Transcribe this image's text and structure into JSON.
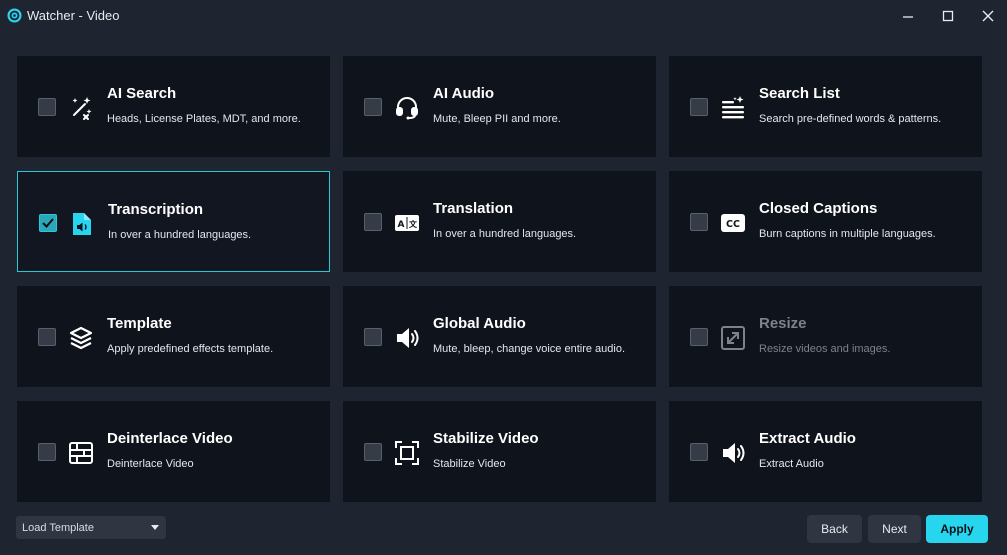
{
  "window": {
    "title": "Watcher - Video"
  },
  "cards": [
    {
      "title": "AI Search",
      "description": "Heads, License Plates, MDT, and more.",
      "icon": "magic-wand-icon",
      "checked": false,
      "disabled": false
    },
    {
      "title": "AI Audio",
      "description": "Mute, Bleep PII and more.",
      "icon": "headset-icon",
      "checked": false,
      "disabled": false
    },
    {
      "title": "Search List",
      "description": "Search pre-defined words & patterns.",
      "icon": "sparkle-list-icon",
      "checked": false,
      "disabled": false
    },
    {
      "title": "Transcription",
      "description": "In over a hundred languages.",
      "icon": "audio-file-icon",
      "checked": true,
      "disabled": false
    },
    {
      "title": "Translation",
      "description": "In over a hundred languages.",
      "icon": "translate-icon",
      "checked": false,
      "disabled": false
    },
    {
      "title": "Closed Captions",
      "description": "Burn captions in multiple languages.",
      "icon": "cc-icon",
      "checked": false,
      "disabled": false
    },
    {
      "title": "Template",
      "description": "Apply predefined effects template.",
      "icon": "layers-icon",
      "checked": false,
      "disabled": false
    },
    {
      "title": "Global Audio",
      "description": "Mute, bleep, change voice entire audio.",
      "icon": "speaker-icon",
      "checked": false,
      "disabled": false
    },
    {
      "title": "Resize",
      "description": "Resize videos and images.",
      "icon": "resize-icon",
      "checked": false,
      "disabled": true
    },
    {
      "title": "Deinterlace Video",
      "description": "Deinterlace Video",
      "icon": "deinterlace-icon",
      "checked": false,
      "disabled": false
    },
    {
      "title": "Stabilize Video",
      "description": "Stabilize Video",
      "icon": "stabilize-icon",
      "checked": false,
      "disabled": false
    },
    {
      "title": "Extract Audio",
      "description": "Extract Audio",
      "icon": "speaker-icon",
      "checked": false,
      "disabled": false
    }
  ],
  "footer": {
    "load_template": "Load Template",
    "back_label": "Back",
    "next_label": "Next",
    "apply_label": "Apply"
  },
  "colors": {
    "accent": "#27d6ee",
    "card_bg": "#0f131b",
    "window_bg": "#1e2430",
    "selected_border": "#29c6d6"
  }
}
